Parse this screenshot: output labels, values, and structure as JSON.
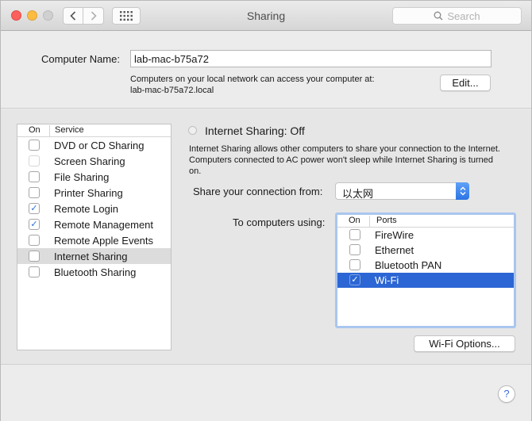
{
  "window": {
    "title": "Sharing",
    "search_placeholder": "Search"
  },
  "computer_name": {
    "label": "Computer Name:",
    "value": "lab-mac-b75a72",
    "info_line1": "Computers on your local network can access your computer at:",
    "info_line2": "lab-mac-b75a72.local",
    "edit_label": "Edit..."
  },
  "services": {
    "header_on": "On",
    "header_service": "Service",
    "items": [
      {
        "label": "DVD or CD Sharing",
        "checked": false,
        "dim": false,
        "selected": false
      },
      {
        "label": "Screen Sharing",
        "checked": false,
        "dim": true,
        "selected": false
      },
      {
        "label": "File Sharing",
        "checked": false,
        "dim": false,
        "selected": false
      },
      {
        "label": "Printer Sharing",
        "checked": false,
        "dim": false,
        "selected": false
      },
      {
        "label": "Remote Login",
        "checked": true,
        "dim": false,
        "selected": false
      },
      {
        "label": "Remote Management",
        "checked": true,
        "dim": false,
        "selected": false
      },
      {
        "label": "Remote Apple Events",
        "checked": false,
        "dim": false,
        "selected": false
      },
      {
        "label": "Internet Sharing",
        "checked": false,
        "dim": false,
        "selected": true
      },
      {
        "label": "Bluetooth Sharing",
        "checked": false,
        "dim": false,
        "selected": false
      }
    ]
  },
  "internet_sharing": {
    "status": "Internet Sharing: Off",
    "description": "Internet Sharing allows other computers to share your connection to the Internet. Computers connected to AC power won't sleep while Internet Sharing is turned on.",
    "share_from_label": "Share your connection from:",
    "share_from_value": "以太网",
    "to_computers_label": "To computers using:",
    "ports_header_on": "On",
    "ports_header_ports": "Ports",
    "ports": [
      {
        "label": "FireWire",
        "checked": false,
        "selected": false
      },
      {
        "label": "Ethernet",
        "checked": false,
        "selected": false
      },
      {
        "label": "Bluetooth PAN",
        "checked": false,
        "selected": false
      },
      {
        "label": "Wi-Fi",
        "checked": true,
        "selected": true
      }
    ],
    "wifi_options_label": "Wi-Fi Options..."
  },
  "help_label": "?",
  "check_glyph": "✓",
  "colors": {
    "selection_blue": "#2c66d4",
    "checkmark_blue": "#2b6fd6"
  }
}
